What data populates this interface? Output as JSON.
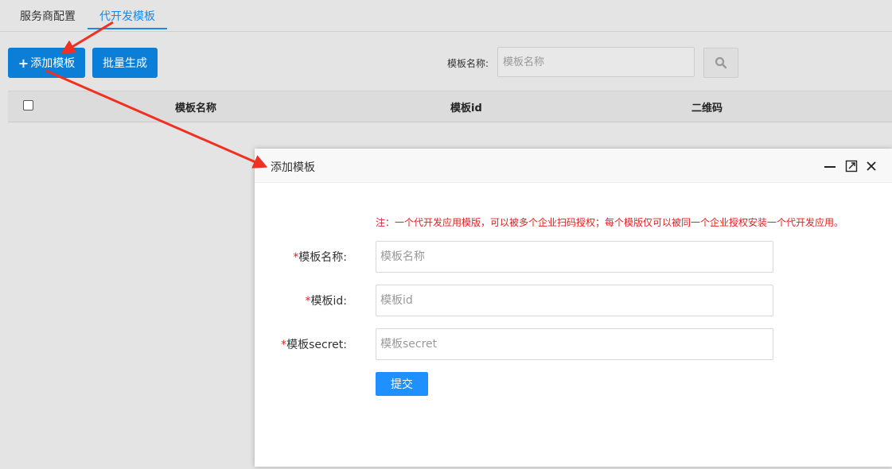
{
  "tabs": [
    {
      "label": "服务商配置",
      "active": false
    },
    {
      "label": "代开发模板",
      "active": true
    }
  ],
  "toolbar": {
    "add_label": "添加模板",
    "batch_label": "批量生成",
    "search_label": "模板名称:",
    "search_placeholder": "模板名称"
  },
  "table": {
    "columns": [
      "模板名称",
      "模板id",
      "二维码"
    ]
  },
  "dialog": {
    "title": "添加模板",
    "note": "注：一个代开发应用模版，可以被多个企业扫码授权；每个模版仅可以被同一个企业授权安装一个代开发应用。",
    "fields": [
      {
        "label": "模板名称:",
        "placeholder": "模板名称",
        "required_mark": "*"
      },
      {
        "label": "模板id:",
        "placeholder": "模板id",
        "required_mark": "*"
      },
      {
        "label": "模板secret:",
        "placeholder": "模板secret",
        "required_mark": "*"
      }
    ],
    "submit_label": "提交"
  },
  "colors": {
    "primary": "#0b7fd8",
    "submit": "#1e90ff",
    "tab_active": "#1e88e5",
    "required": "#e02020",
    "annotation_arrow": "#f03020"
  }
}
